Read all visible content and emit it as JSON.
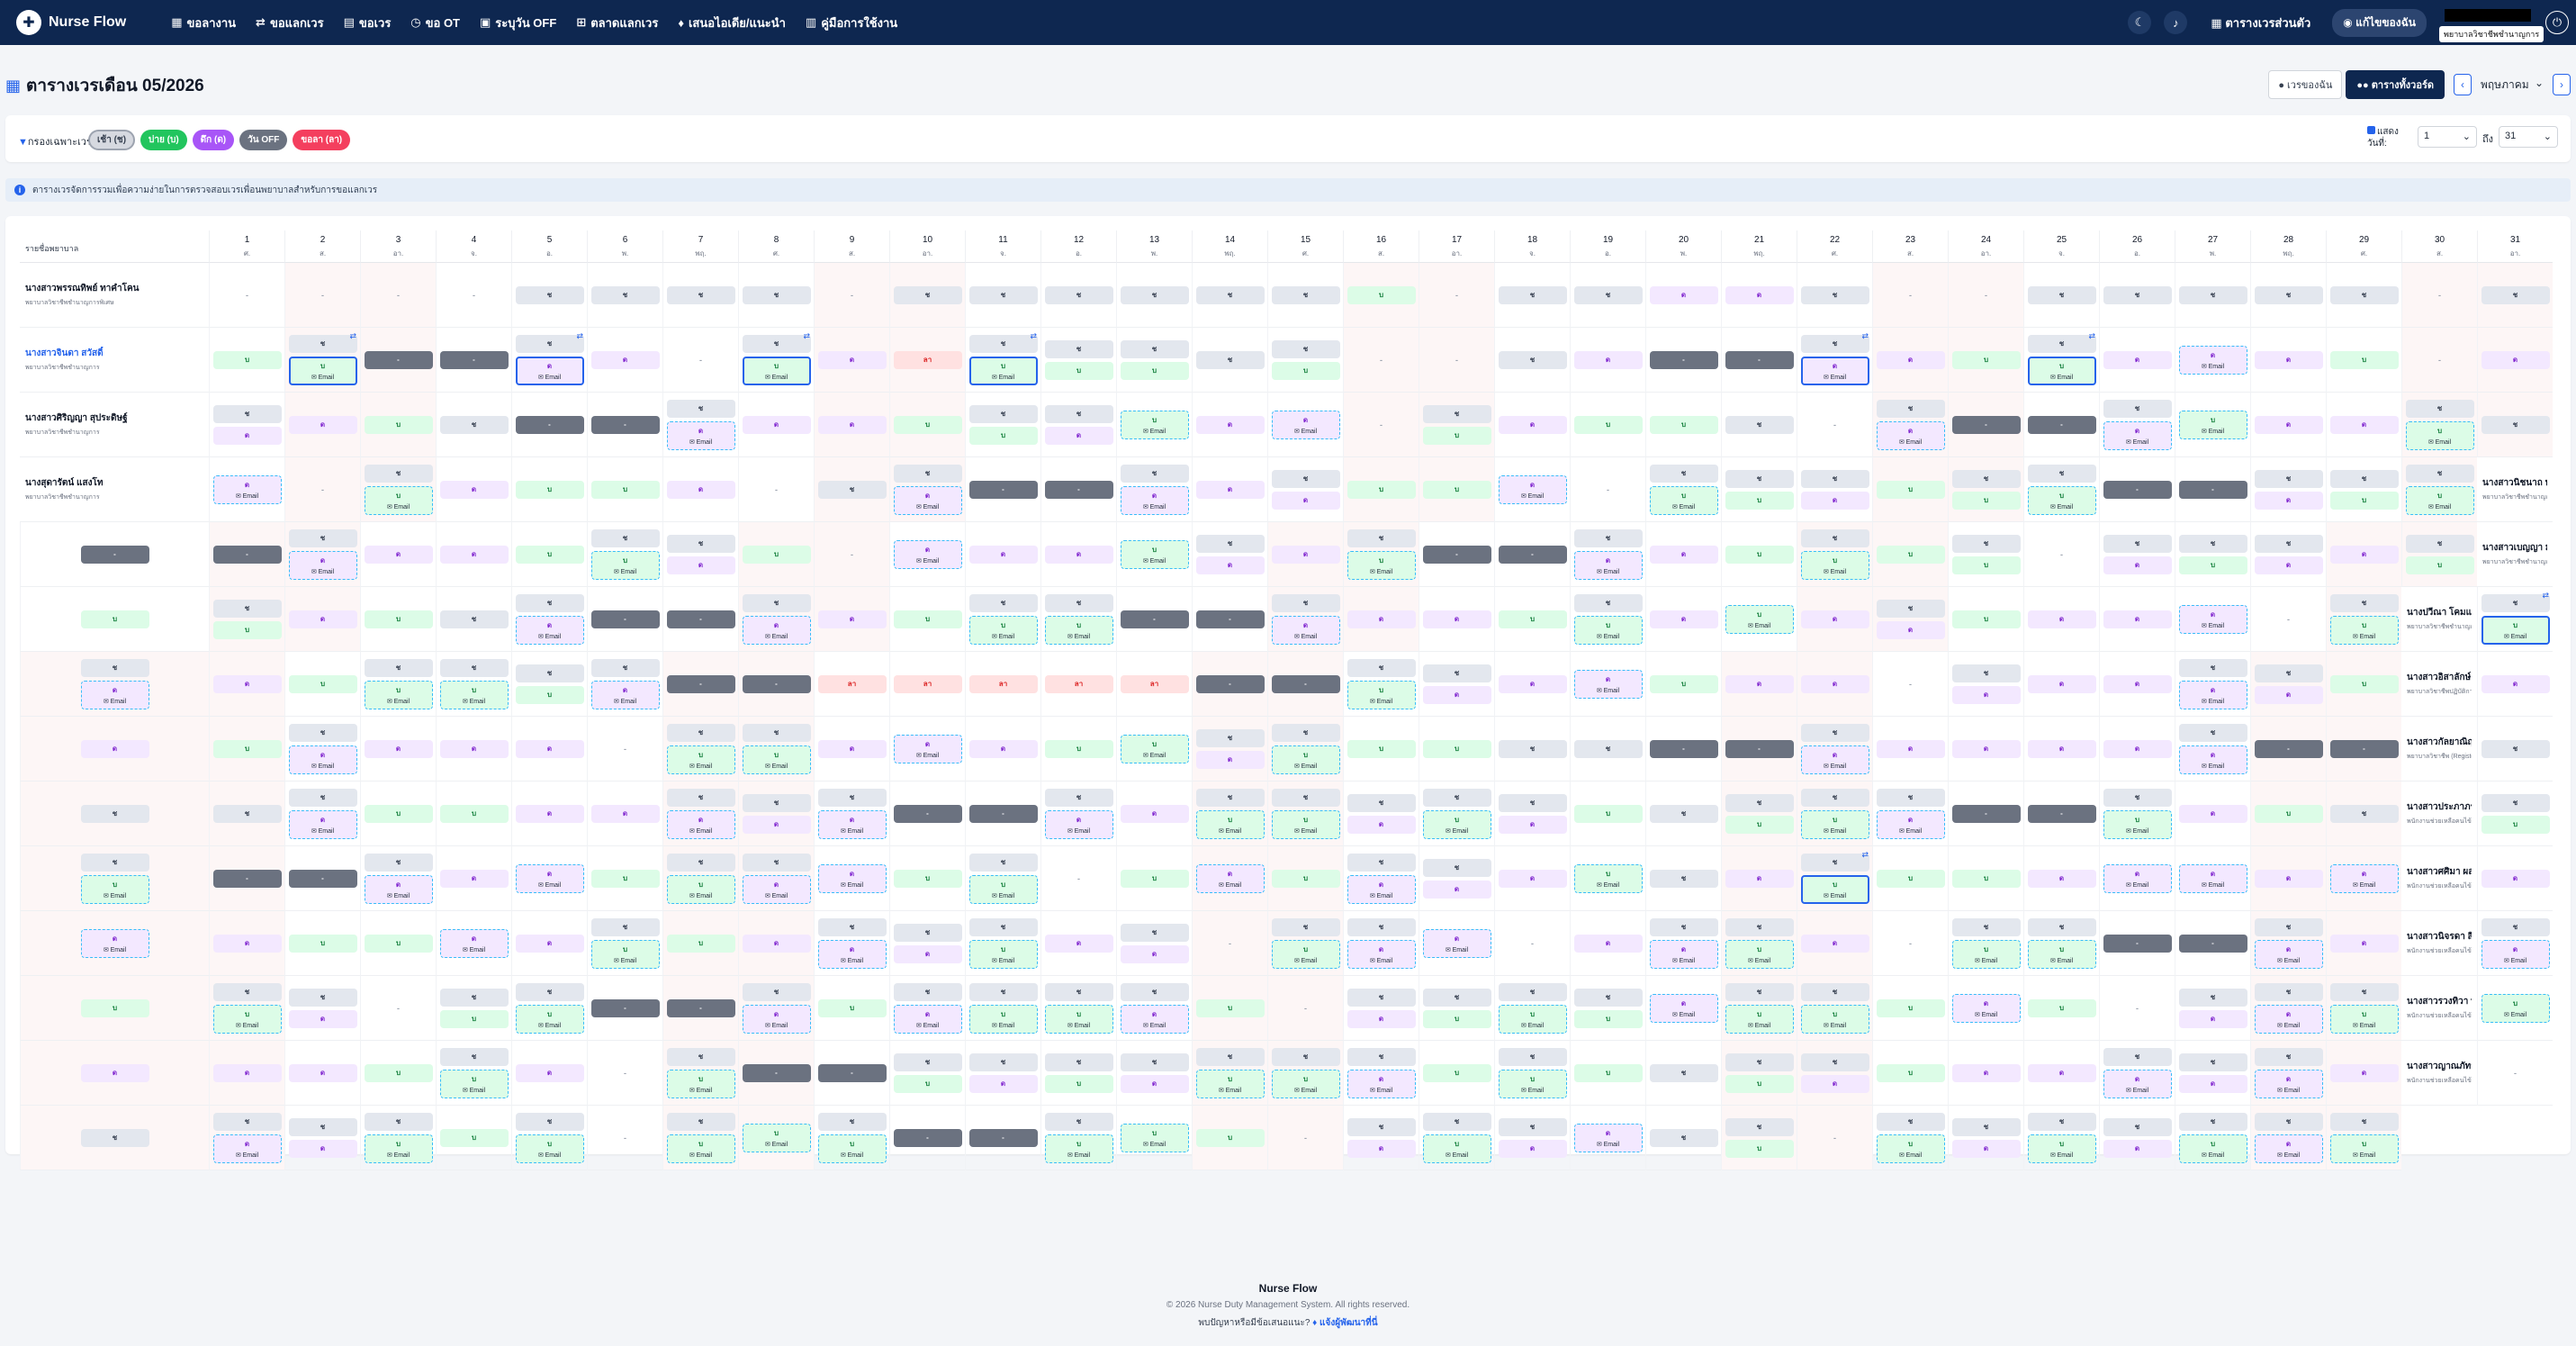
{
  "nav": {
    "brand": "Nurse Flow",
    "items": [
      {
        "icon": "▦",
        "label": "ขอลางาน"
      },
      {
        "icon": "⇄",
        "label": "ขอแลกเวร"
      },
      {
        "icon": "▤",
        "label": "ขอเวร"
      },
      {
        "icon": "◷",
        "label": "ขอ OT"
      },
      {
        "icon": "▣",
        "label": "ระบุวัน OFF"
      },
      {
        "icon": "⊞",
        "label": "ตลาดแลกเวร"
      },
      {
        "icon": "♦",
        "label": "เสนอไอเดีย/แนะนำ"
      },
      {
        "icon": "▥",
        "label": "คู่มือการใช้งาน"
      }
    ],
    "personal_schedule": "ตารางเวรส่วนตัว",
    "profile_label": "แก้ไขของฉัน",
    "user_role": "พยาบาลวิชาชีพชำนาญการ"
  },
  "page": {
    "title": "ตารางเวรเดือน 05/2026",
    "btn_my_schedule": "เวรของฉัน",
    "btn_all_schedule": "ตารางทั้งวอร์ด",
    "month_value": "พฤษภาคม"
  },
  "filter": {
    "label": "กรองเฉพาะเวร:",
    "chips": [
      "เช้า (ช)",
      "บ่าย (บ)",
      "ดึก (ด)",
      "วัน OFF",
      "ขอลา (ลา)"
    ],
    "show_label": "แสดง",
    "day_label": "วันที่:",
    "from_value": "1",
    "to_label": "ถึง",
    "to_value": "31"
  },
  "info_text": "ตารางเวรจัดการรวมเพื่อความง่ายในการตรวจสอบเวรเพื่อนพยาบาลสำหรับการขอแลกเวร",
  "header_name_col": "รายชื่อพยาบาล",
  "days": [
    {
      "d": "1",
      "w": "ศ."
    },
    {
      "d": "2",
      "w": "ส."
    },
    {
      "d": "3",
      "w": "อา."
    },
    {
      "d": "4",
      "w": "จ."
    },
    {
      "d": "5",
      "w": "อ."
    },
    {
      "d": "6",
      "w": "พ."
    },
    {
      "d": "7",
      "w": "พฤ."
    },
    {
      "d": "8",
      "w": "ศ."
    },
    {
      "d": "9",
      "w": "ส."
    },
    {
      "d": "10",
      "w": "อา."
    },
    {
      "d": "11",
      "w": "จ."
    },
    {
      "d": "12",
      "w": "อ."
    },
    {
      "d": "13",
      "w": "พ."
    },
    {
      "d": "14",
      "w": "พฤ."
    },
    {
      "d": "15",
      "w": "ศ."
    },
    {
      "d": "16",
      "w": "ส."
    },
    {
      "d": "17",
      "w": "อา."
    },
    {
      "d": "18",
      "w": "จ."
    },
    {
      "d": "19",
      "w": "อ."
    },
    {
      "d": "20",
      "w": "พ."
    },
    {
      "d": "21",
      "w": "พฤ."
    },
    {
      "d": "22",
      "w": "ศ."
    },
    {
      "d": "23",
      "w": "ส."
    },
    {
      "d": "24",
      "w": "อา."
    },
    {
      "d": "25",
      "w": "จ."
    },
    {
      "d": "26",
      "w": "อ."
    },
    {
      "d": "27",
      "w": "พ."
    },
    {
      "d": "28",
      "w": "พฤ."
    },
    {
      "d": "29",
      "w": "ศ."
    },
    {
      "d": "30",
      "w": "ส."
    },
    {
      "d": "31",
      "w": "อา."
    }
  ],
  "shift_labels": {
    "m": "ช",
    "a": "บ",
    "n": "ด",
    "o": "-",
    "l": "ลา",
    "e": "-",
    "sw_tag": "Email"
  },
  "nurses": [
    {
      "name": "นางสาวพรรณทิพย์ ทาคำโคน",
      "position": "พยาบาลวิชาชีพชำนาญการพิเศษ"
    },
    {
      "name": "นางสาวจินดา สวัสดิ์",
      "position": "พยาบาลวิชาชีพชำนาญการ"
    },
    {
      "name": "นางสาวศิริญญา สุประดิษฐ์",
      "position": "พยาบาลวิชาชีพชำนาญการ"
    },
    {
      "name": "นางสุดารัตน์ แสงโท",
      "position": "พยาบาลวิชาชีพชำนาญการ"
    },
    {
      "name": "นางสาวนิชนาถ บุญรักษา",
      "position": "พยาบาลวิชาชีพชำนาญการ"
    },
    {
      "name": "นางสาวเบญญา มณศรี",
      "position": "พยาบาลวิชาชีพชำนาญการ"
    },
    {
      "name": "นางปวีณา โคมแพลม",
      "position": "พยาบาลวิชาชีพชำนาญการ"
    },
    {
      "name": "นางสาวอิสาลักษ์ รัตนพิชิตภัทร",
      "position": "พยาบาลวิชาชีพปฏิบัติการ"
    },
    {
      "name": "นางสาวกัลยาณิญญ์ คำวร",
      "position": "พยาบาลวิชาชีพ (Registered Nurse - RN)"
    },
    {
      "name": "นางสาวประภาภรณ์ พันธ์มะ",
      "position": "พนักงานช่วยเหลือคนไข้ (Nurse Aid - NA)"
    },
    {
      "name": "นางสาวศศิมา ผลจินดา",
      "position": "พนักงานช่วยเหลือคนไข้ (Nurse Aid - NA)"
    },
    {
      "name": "นางสาวนิจรดา สิญโญ",
      "position": "พนักงานช่วยเหลือคนไข้ (Nurse Aid - NA)"
    },
    {
      "name": "นางสาวรวงทิวา ทันจันทร์",
      "position": "พนักงานช่วยเหลือคนไข้ (Nurse Aid - NA)"
    },
    {
      "name": "นางสาวญาณภัทร เหล่าชา",
      "position": "พนักงานช่วยเหลือคนไข้ (Nurse Aid - NA)"
    }
  ],
  "schedule": [
    [
      "e",
      "e",
      "e",
      "e",
      "m",
      "m",
      "m",
      "m",
      "e",
      "m",
      "m",
      "m",
      "m",
      "m",
      "m",
      "a",
      "e",
      "m",
      "m",
      "n",
      "n",
      "m",
      "e",
      "e",
      "m",
      "m",
      "m",
      "m",
      "m",
      "e",
      "m"
    ],
    [
      "a",
      "m,A*",
      "o",
      "o",
      "m,N*",
      "n",
      "e",
      "m,A*",
      "n",
      "l",
      "m,A*",
      "m,a",
      "m,a",
      "m",
      "m,a",
      "e",
      "e",
      "m",
      "n",
      "o",
      "o",
      "m,N*",
      "n",
      "a",
      "m,A*",
      "n",
      "N",
      "n",
      "a",
      "e",
      "n"
    ],
    [
      "m,n",
      "n",
      "a",
      "m",
      "o",
      "o",
      "m,N",
      "n",
      "n",
      "a",
      "m,a",
      "m,n",
      "A",
      "n",
      "N",
      "e",
      "m,a",
      "n",
      "a",
      "a",
      "m",
      "e",
      "m,N",
      "o",
      "o",
      "m,N",
      "A",
      "n",
      "n",
      "m,A",
      "m"
    ],
    [
      "N",
      "e",
      "m,A",
      "n",
      "a",
      "a",
      "n",
      "e",
      "m",
      "m,N",
      "o",
      "o",
      "m,N",
      "n",
      "m,n",
      "a",
      "a",
      "N",
      "e",
      "m,A",
      "m,a",
      "m,n",
      "a",
      "m,a",
      "m,A",
      "o",
      "o",
      "m,n",
      "m,a",
      "m,A"
    ],
    [
      "o",
      "o",
      "m,N",
      "n",
      "n",
      "a",
      "m,A",
      "m,n",
      "a",
      "e",
      "N",
      "n",
      "n",
      "A",
      "m,n",
      "n",
      "m,A",
      "o",
      "o",
      "m,N",
      "n",
      "a",
      "m,A",
      "a",
      "m,a",
      "e",
      "m,n",
      "m,a",
      "m,n",
      "n",
      "m,a"
    ],
    [
      "a",
      "m,a",
      "n",
      "a",
      "m",
      "m,N",
      "o",
      "o",
      "m,N",
      "n",
      "a",
      "m,A",
      "m,A",
      "o",
      "o",
      "m,N",
      "n",
      "n",
      "a",
      "m,A",
      "n",
      "A",
      "n",
      "m,n",
      "a",
      "n",
      "n",
      "N",
      "e",
      "m,A"
    ],
    [
      "m,A*",
      "m,N",
      "n",
      "a",
      "m,A",
      "m,A",
      "m,a",
      "m,N",
      "o",
      "o",
      "l",
      "l",
      "l",
      "l",
      "l",
      "o",
      "o",
      "m,A",
      "m,n",
      "n",
      "N",
      "a",
      "n",
      "n",
      "e",
      "m,n",
      "n",
      "n",
      "m,N",
      "m,n",
      "a"
    ],
    [
      "n",
      "n",
      "a",
      "m,N",
      "n",
      "n",
      "n",
      "e",
      "m,A",
      "m,A",
      "n",
      "N",
      "n",
      "a",
      "A",
      "m,n",
      "m,A",
      "a",
      "a",
      "m",
      "m",
      "o",
      "o",
      "m,N",
      "n",
      "n",
      "n",
      "n",
      "m,N",
      "o",
      "o"
    ],
    [
      "m",
      "m",
      "m",
      "m,N",
      "a",
      "a",
      "n",
      "n",
      "m,N",
      "m,n",
      "m,N",
      "o",
      "o",
      "m,N",
      "n",
      "m,A",
      "m,A",
      "m,n",
      "m,A",
      "m,n",
      "a",
      "m",
      "m,a",
      "m,A",
      "m,N",
      "o",
      "o",
      "m,A",
      "n",
      "a",
      "m"
    ],
    [
      "m,a",
      "m,A",
      "o",
      "o",
      "m,N",
      "n",
      "N",
      "a",
      "m,A",
      "m,N",
      "N",
      "a",
      "m,A",
      "e",
      "a",
      "N",
      "a",
      "m,N",
      "m,n",
      "n",
      "A",
      "m",
      "n",
      "m,A*",
      "a",
      "a",
      "n",
      "N",
      "N",
      "n",
      "N"
    ],
    [
      "n",
      "N",
      "n",
      "a",
      "a",
      "N",
      "n",
      "m,A",
      "a",
      "n",
      "m,N",
      "m,n",
      "m,A",
      "n",
      "m,n",
      "e",
      "m,A",
      "m,N",
      "N",
      "e",
      "n",
      "m,N",
      "m,A",
      "n",
      "e",
      "m,A",
      "m,A",
      "o",
      "o",
      "m,N",
      "n"
    ],
    [
      "m,N",
      "a",
      "m,A",
      "m,n",
      "e",
      "m,a",
      "m,A",
      "o",
      "o",
      "m,N",
      "a",
      "m,N",
      "m,A",
      "m,A",
      "m,N",
      "a",
      "e",
      "m,n",
      "m,a",
      "m,A",
      "m,a",
      "N",
      "m,A",
      "m,A",
      "a",
      "N",
      "a",
      "e",
      "m,n",
      "m,N",
      "m,A"
    ],
    [
      "A",
      "n",
      "n",
      "n",
      "a",
      "m,A",
      "n",
      "e",
      "m,A",
      "o",
      "o",
      "m,a",
      "m,n",
      "m,a",
      "m,n",
      "m,A",
      "m,A",
      "m,N",
      "a",
      "m,A",
      "a",
      "m",
      "m,a",
      "m,n",
      "a",
      "n",
      "n",
      "m,N",
      "m,n",
      "m,N",
      "n"
    ],
    [
      "e",
      "m",
      "m,N",
      "m,n",
      "m,A",
      "a",
      "m,A",
      "e",
      "m,A",
      "A",
      "m,A",
      "o",
      "o",
      "m,A",
      "A",
      "a",
      "e",
      "m,n",
      "m,A",
      "m,n",
      "N",
      "m",
      "m,a",
      "e",
      "m,A",
      "m,n",
      "m,A",
      "m,n",
      "m,A",
      "m,N",
      "m,A"
    ]
  ]
}
